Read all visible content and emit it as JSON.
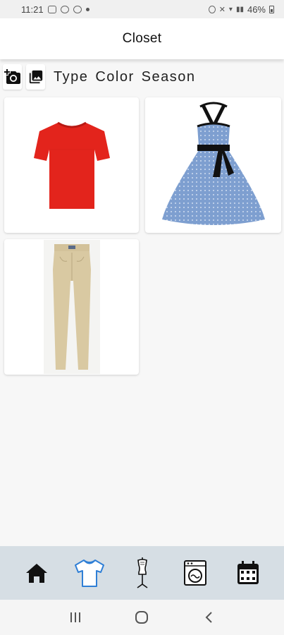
{
  "status_bar": {
    "time": "11:21",
    "battery": "46%"
  },
  "app_bar": {
    "title": "Closet"
  },
  "toolbar": {
    "filters": [
      "Type",
      "Color",
      "Season"
    ]
  },
  "closet_items": [
    {
      "name": "Red T-Shirt",
      "color": "#e3241c"
    },
    {
      "name": "Blue Polka Dot Halter Dress",
      "color": "#7e9fd0"
    },
    {
      "name": "Khaki Trousers",
      "color": "#d9c9a2"
    }
  ],
  "bottom_nav": {
    "items": [
      {
        "icon": "home-icon",
        "active": false
      },
      {
        "icon": "shirt-icon",
        "active": true
      },
      {
        "icon": "mannequin-icon",
        "active": false
      },
      {
        "icon": "washing-machine-icon",
        "active": false
      },
      {
        "icon": "calendar-icon",
        "active": false
      }
    ],
    "active_color": "#2f7fd6"
  }
}
